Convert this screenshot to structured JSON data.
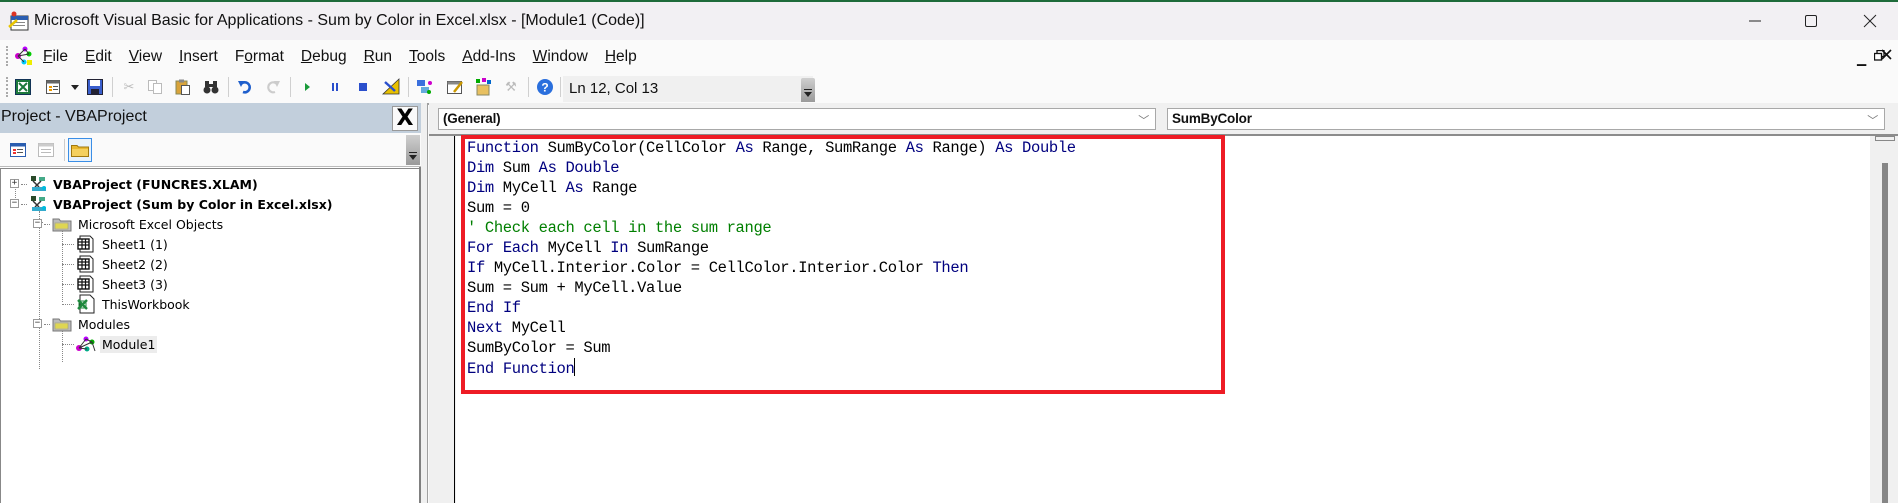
{
  "window": {
    "title": "Microsoft Visual Basic for Applications - Sum by Color in Excel.xlsx - [Module1 (Code)]",
    "controls": {
      "minimize": "—",
      "maximize": "☐",
      "close": "✕"
    },
    "mdi_controls": {
      "minimize": "_",
      "restore": "🗗",
      "close": "✕"
    }
  },
  "menu": {
    "items": [
      {
        "label": "File",
        "mnemonic": "F"
      },
      {
        "label": "Edit",
        "mnemonic": "E"
      },
      {
        "label": "View",
        "mnemonic": "V"
      },
      {
        "label": "Insert",
        "mnemonic": "I"
      },
      {
        "label": "Format",
        "mnemonic": "o"
      },
      {
        "label": "Debug",
        "mnemonic": "D"
      },
      {
        "label": "Run",
        "mnemonic": "R"
      },
      {
        "label": "Tools",
        "mnemonic": "T"
      },
      {
        "label": "Add-Ins",
        "mnemonic": "A"
      },
      {
        "label": "Window",
        "mnemonic": "W"
      },
      {
        "label": "Help",
        "mnemonic": "H"
      }
    ]
  },
  "toolbar": {
    "buttons": [
      {
        "name": "view-excel-icon"
      },
      {
        "name": "insert-userform-icon"
      },
      {
        "name": "dropdown-arrow-icon"
      },
      {
        "name": "save-icon"
      },
      {
        "name": "cut-icon"
      },
      {
        "name": "copy-icon"
      },
      {
        "name": "paste-icon"
      },
      {
        "name": "find-icon"
      },
      {
        "name": "undo-icon"
      },
      {
        "name": "redo-icon"
      },
      {
        "name": "run-icon"
      },
      {
        "name": "break-icon"
      },
      {
        "name": "reset-icon"
      },
      {
        "name": "design-mode-icon"
      },
      {
        "name": "project-explorer-icon"
      },
      {
        "name": "properties-window-icon"
      },
      {
        "name": "object-browser-icon"
      },
      {
        "name": "toolbox-icon"
      },
      {
        "name": "help-icon"
      }
    ],
    "status": "Ln 12, Col 13"
  },
  "project_panel": {
    "title": "Project - VBAProject",
    "close_label": "X",
    "tree": [
      {
        "label": "VBAProject (FUNCRES.XLAM)",
        "bold": true,
        "expander": "+",
        "icon": "vba-project-icon",
        "level": 0
      },
      {
        "label": "VBAProject (Sum by Color in Excel.xlsx)",
        "bold": true,
        "expander": "−",
        "icon": "vba-project-icon",
        "level": 0
      },
      {
        "label": "Microsoft Excel Objects",
        "bold": false,
        "expander": "−",
        "icon": "folder-icon",
        "level": 1
      },
      {
        "label": "Sheet1 (1)",
        "bold": false,
        "icon": "worksheet-icon",
        "level": 2
      },
      {
        "label": "Sheet2 (2)",
        "bold": false,
        "icon": "worksheet-icon",
        "level": 2
      },
      {
        "label": "Sheet3 (3)",
        "bold": false,
        "icon": "worksheet-icon",
        "level": 2
      },
      {
        "label": "ThisWorkbook",
        "bold": false,
        "icon": "workbook-icon",
        "level": 2
      },
      {
        "label": "Modules",
        "bold": false,
        "expander": "−",
        "icon": "folder-icon",
        "level": 1
      },
      {
        "label": "Module1",
        "bold": false,
        "icon": "module-icon",
        "level": 2,
        "selected": true
      }
    ]
  },
  "code_window": {
    "object_dropdown": "(General)",
    "procedure_dropdown": "SumByColor",
    "colors": {
      "keyword": "#00007f",
      "comment": "#007f00",
      "text": "#000000",
      "highlight_box": "#ee1c25"
    },
    "lines": [
      [
        {
          "t": "kw",
          "v": "Function"
        },
        {
          "t": "tx",
          "v": " SumByColor(CellColor "
        },
        {
          "t": "kw",
          "v": "As"
        },
        {
          "t": "tx",
          "v": " Range, SumRange "
        },
        {
          "t": "kw",
          "v": "As"
        },
        {
          "t": "tx",
          "v": " Range) "
        },
        {
          "t": "kw",
          "v": "As"
        },
        {
          "t": "tx",
          "v": " "
        },
        {
          "t": "kw",
          "v": "Double"
        }
      ],
      [
        {
          "t": "kw",
          "v": "Dim"
        },
        {
          "t": "tx",
          "v": " Sum "
        },
        {
          "t": "kw",
          "v": "As"
        },
        {
          "t": "tx",
          "v": " "
        },
        {
          "t": "kw",
          "v": "Double"
        }
      ],
      [
        {
          "t": "kw",
          "v": "Dim"
        },
        {
          "t": "tx",
          "v": " MyCell "
        },
        {
          "t": "kw",
          "v": "As"
        },
        {
          "t": "tx",
          "v": " Range"
        }
      ],
      [
        {
          "t": "tx",
          "v": "Sum = 0"
        }
      ],
      [
        {
          "t": "cm",
          "v": "' Check each cell in the sum range"
        }
      ],
      [
        {
          "t": "kw",
          "v": "For"
        },
        {
          "t": "tx",
          "v": " "
        },
        {
          "t": "kw",
          "v": "Each"
        },
        {
          "t": "tx",
          "v": " MyCell "
        },
        {
          "t": "kw",
          "v": "In"
        },
        {
          "t": "tx",
          "v": " SumRange"
        }
      ],
      [
        {
          "t": "kw",
          "v": "If"
        },
        {
          "t": "tx",
          "v": " MyCell.Interior.Color = CellColor.Interior.Color "
        },
        {
          "t": "kw",
          "v": "Then"
        }
      ],
      [
        {
          "t": "tx",
          "v": "Sum = Sum + MyCell.Value"
        }
      ],
      [
        {
          "t": "kw",
          "v": "End"
        },
        {
          "t": "tx",
          "v": " "
        },
        {
          "t": "kw",
          "v": "If"
        }
      ],
      [
        {
          "t": "kw",
          "v": "Next"
        },
        {
          "t": "tx",
          "v": " MyCell"
        }
      ],
      [
        {
          "t": "tx",
          "v": "SumByColor = Sum"
        }
      ],
      [
        {
          "t": "kw",
          "v": "End"
        },
        {
          "t": "tx",
          "v": " "
        },
        {
          "t": "kw",
          "v": "Function"
        }
      ]
    ],
    "caret_line": 12
  }
}
